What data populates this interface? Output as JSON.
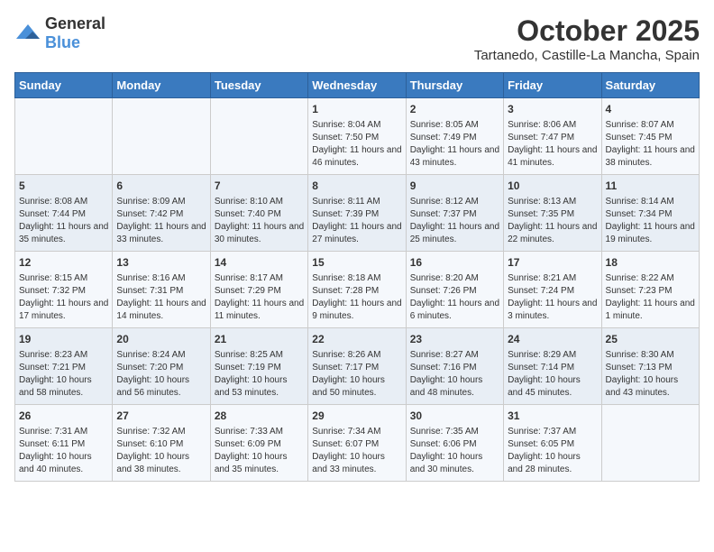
{
  "logo": {
    "general": "General",
    "blue": "Blue"
  },
  "title": "October 2025",
  "location": "Tartanedo, Castille-La Mancha, Spain",
  "days_of_week": [
    "Sunday",
    "Monday",
    "Tuesday",
    "Wednesday",
    "Thursday",
    "Friday",
    "Saturday"
  ],
  "weeks": [
    [
      {
        "day": "",
        "info": ""
      },
      {
        "day": "",
        "info": ""
      },
      {
        "day": "",
        "info": ""
      },
      {
        "day": "1",
        "info": "Sunrise: 8:04 AM\nSunset: 7:50 PM\nDaylight: 11 hours and 46 minutes."
      },
      {
        "day": "2",
        "info": "Sunrise: 8:05 AM\nSunset: 7:49 PM\nDaylight: 11 hours and 43 minutes."
      },
      {
        "day": "3",
        "info": "Sunrise: 8:06 AM\nSunset: 7:47 PM\nDaylight: 11 hours and 41 minutes."
      },
      {
        "day": "4",
        "info": "Sunrise: 8:07 AM\nSunset: 7:45 PM\nDaylight: 11 hours and 38 minutes."
      }
    ],
    [
      {
        "day": "5",
        "info": "Sunrise: 8:08 AM\nSunset: 7:44 PM\nDaylight: 11 hours and 35 minutes."
      },
      {
        "day": "6",
        "info": "Sunrise: 8:09 AM\nSunset: 7:42 PM\nDaylight: 11 hours and 33 minutes."
      },
      {
        "day": "7",
        "info": "Sunrise: 8:10 AM\nSunset: 7:40 PM\nDaylight: 11 hours and 30 minutes."
      },
      {
        "day": "8",
        "info": "Sunrise: 8:11 AM\nSunset: 7:39 PM\nDaylight: 11 hours and 27 minutes."
      },
      {
        "day": "9",
        "info": "Sunrise: 8:12 AM\nSunset: 7:37 PM\nDaylight: 11 hours and 25 minutes."
      },
      {
        "day": "10",
        "info": "Sunrise: 8:13 AM\nSunset: 7:35 PM\nDaylight: 11 hours and 22 minutes."
      },
      {
        "day": "11",
        "info": "Sunrise: 8:14 AM\nSunset: 7:34 PM\nDaylight: 11 hours and 19 minutes."
      }
    ],
    [
      {
        "day": "12",
        "info": "Sunrise: 8:15 AM\nSunset: 7:32 PM\nDaylight: 11 hours and 17 minutes."
      },
      {
        "day": "13",
        "info": "Sunrise: 8:16 AM\nSunset: 7:31 PM\nDaylight: 11 hours and 14 minutes."
      },
      {
        "day": "14",
        "info": "Sunrise: 8:17 AM\nSunset: 7:29 PM\nDaylight: 11 hours and 11 minutes."
      },
      {
        "day": "15",
        "info": "Sunrise: 8:18 AM\nSunset: 7:28 PM\nDaylight: 11 hours and 9 minutes."
      },
      {
        "day": "16",
        "info": "Sunrise: 8:20 AM\nSunset: 7:26 PM\nDaylight: 11 hours and 6 minutes."
      },
      {
        "day": "17",
        "info": "Sunrise: 8:21 AM\nSunset: 7:24 PM\nDaylight: 11 hours and 3 minutes."
      },
      {
        "day": "18",
        "info": "Sunrise: 8:22 AM\nSunset: 7:23 PM\nDaylight: 11 hours and 1 minute."
      }
    ],
    [
      {
        "day": "19",
        "info": "Sunrise: 8:23 AM\nSunset: 7:21 PM\nDaylight: 10 hours and 58 minutes."
      },
      {
        "day": "20",
        "info": "Sunrise: 8:24 AM\nSunset: 7:20 PM\nDaylight: 10 hours and 56 minutes."
      },
      {
        "day": "21",
        "info": "Sunrise: 8:25 AM\nSunset: 7:19 PM\nDaylight: 10 hours and 53 minutes."
      },
      {
        "day": "22",
        "info": "Sunrise: 8:26 AM\nSunset: 7:17 PM\nDaylight: 10 hours and 50 minutes."
      },
      {
        "day": "23",
        "info": "Sunrise: 8:27 AM\nSunset: 7:16 PM\nDaylight: 10 hours and 48 minutes."
      },
      {
        "day": "24",
        "info": "Sunrise: 8:29 AM\nSunset: 7:14 PM\nDaylight: 10 hours and 45 minutes."
      },
      {
        "day": "25",
        "info": "Sunrise: 8:30 AM\nSunset: 7:13 PM\nDaylight: 10 hours and 43 minutes."
      }
    ],
    [
      {
        "day": "26",
        "info": "Sunrise: 7:31 AM\nSunset: 6:11 PM\nDaylight: 10 hours and 40 minutes."
      },
      {
        "day": "27",
        "info": "Sunrise: 7:32 AM\nSunset: 6:10 PM\nDaylight: 10 hours and 38 minutes."
      },
      {
        "day": "28",
        "info": "Sunrise: 7:33 AM\nSunset: 6:09 PM\nDaylight: 10 hours and 35 minutes."
      },
      {
        "day": "29",
        "info": "Sunrise: 7:34 AM\nSunset: 6:07 PM\nDaylight: 10 hours and 33 minutes."
      },
      {
        "day": "30",
        "info": "Sunrise: 7:35 AM\nSunset: 6:06 PM\nDaylight: 10 hours and 30 minutes."
      },
      {
        "day": "31",
        "info": "Sunrise: 7:37 AM\nSunset: 6:05 PM\nDaylight: 10 hours and 28 minutes."
      },
      {
        "day": "",
        "info": ""
      }
    ]
  ]
}
